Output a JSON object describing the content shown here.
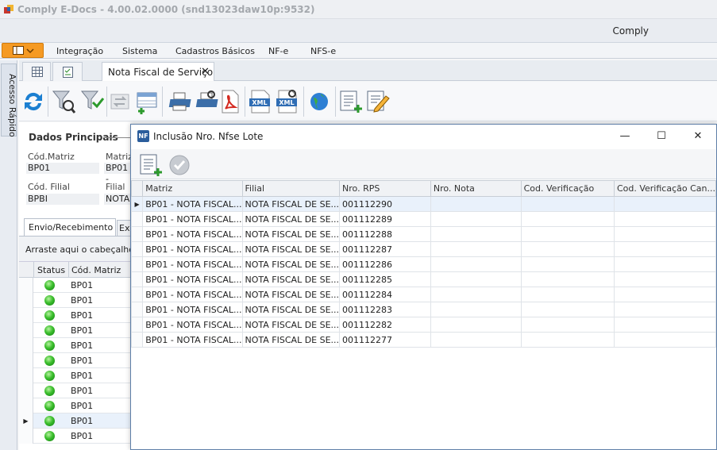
{
  "window": {
    "title": "Comply E-Docs - 4.00.02.0000 (snd13023daw10p:9532)"
  },
  "user": {
    "name": "Comply"
  },
  "menu": {
    "items": [
      "Integração",
      "Sistema",
      "Cadastros Básicos",
      "NF-e",
      "NFS-e"
    ]
  },
  "side": {
    "label": "Acesso Rápido"
  },
  "tabs": {
    "doc_tab": "Nota Fiscal de Serviço",
    "close": "✕"
  },
  "toolbar": {
    "icons": [
      "refresh-icon",
      "filter-icon",
      "clear-filter-icon",
      "disabled-sync-icon",
      "add-grid-icon",
      "print-icon",
      "print-preview-icon",
      "pdf-icon",
      "xml-icon",
      "xml-search-icon",
      "globe-icon",
      "add-list-icon",
      "edit-icon"
    ]
  },
  "main": {
    "section_title": "Dados Principais",
    "cod_matriz_label": "Cód.Matriz",
    "cod_matriz_value": "BP01",
    "matriz_label": "Matriz",
    "matriz_value": "BP01 -",
    "cod_filial_label": "Cód. Filial",
    "cod_filial_value": "BPBI",
    "filial_label": "Filial",
    "filial_value": "NOTA",
    "subtab1": "Envio/Recebimento",
    "subtab2": "Ex",
    "drag_hint": "Arraste aqui o cabeçalho de",
    "col_status": "Status",
    "col_cod_matriz": "Cód. Matriz",
    "rows": [
      "BP01",
      "BP01",
      "BP01",
      "BP01",
      "BP01",
      "BP01",
      "BP01",
      "BP01",
      "BP01",
      "BP01",
      "BP01"
    ]
  },
  "dialog": {
    "title": "Inclusão Nro. Nfse Lote",
    "icon_text": "NF",
    "minimize": "—",
    "maximize": "☐",
    "close": "✕",
    "columns": [
      "Matriz",
      "Filial",
      "Nro. RPS",
      "Nro. Nota",
      "Cod. Verificação",
      "Cod. Verificação Can..."
    ],
    "rows": [
      [
        "BP01 - NOTA FISCAL...",
        "NOTA FISCAL DE SE...",
        "001112290",
        "",
        "",
        ""
      ],
      [
        "BP01 - NOTA FISCAL...",
        "NOTA FISCAL DE SE...",
        "001112289",
        "",
        "",
        ""
      ],
      [
        "BP01 - NOTA FISCAL...",
        "NOTA FISCAL DE SE...",
        "001112288",
        "",
        "",
        ""
      ],
      [
        "BP01 - NOTA FISCAL...",
        "NOTA FISCAL DE SE...",
        "001112287",
        "",
        "",
        ""
      ],
      [
        "BP01 - NOTA FISCAL...",
        "NOTA FISCAL DE SE...",
        "001112286",
        "",
        "",
        ""
      ],
      [
        "BP01 - NOTA FISCAL...",
        "NOTA FISCAL DE SE...",
        "001112285",
        "",
        "",
        ""
      ],
      [
        "BP01 - NOTA FISCAL...",
        "NOTA FISCAL DE SE...",
        "001112284",
        "",
        "",
        ""
      ],
      [
        "BP01 - NOTA FISCAL...",
        "NOTA FISCAL DE SE...",
        "001112283",
        "",
        "",
        ""
      ],
      [
        "BP01 - NOTA FISCAL...",
        "NOTA FISCAL DE SE...",
        "001112282",
        "",
        "",
        ""
      ],
      [
        "BP01 - NOTA FISCAL...",
        "NOTA FISCAL DE SE...",
        "001112277",
        "",
        "",
        ""
      ]
    ]
  },
  "colors": {
    "accent_orange": "#f59a23",
    "dialog_border": "#5f7fa8",
    "selected_row": "#e9f1fb"
  }
}
